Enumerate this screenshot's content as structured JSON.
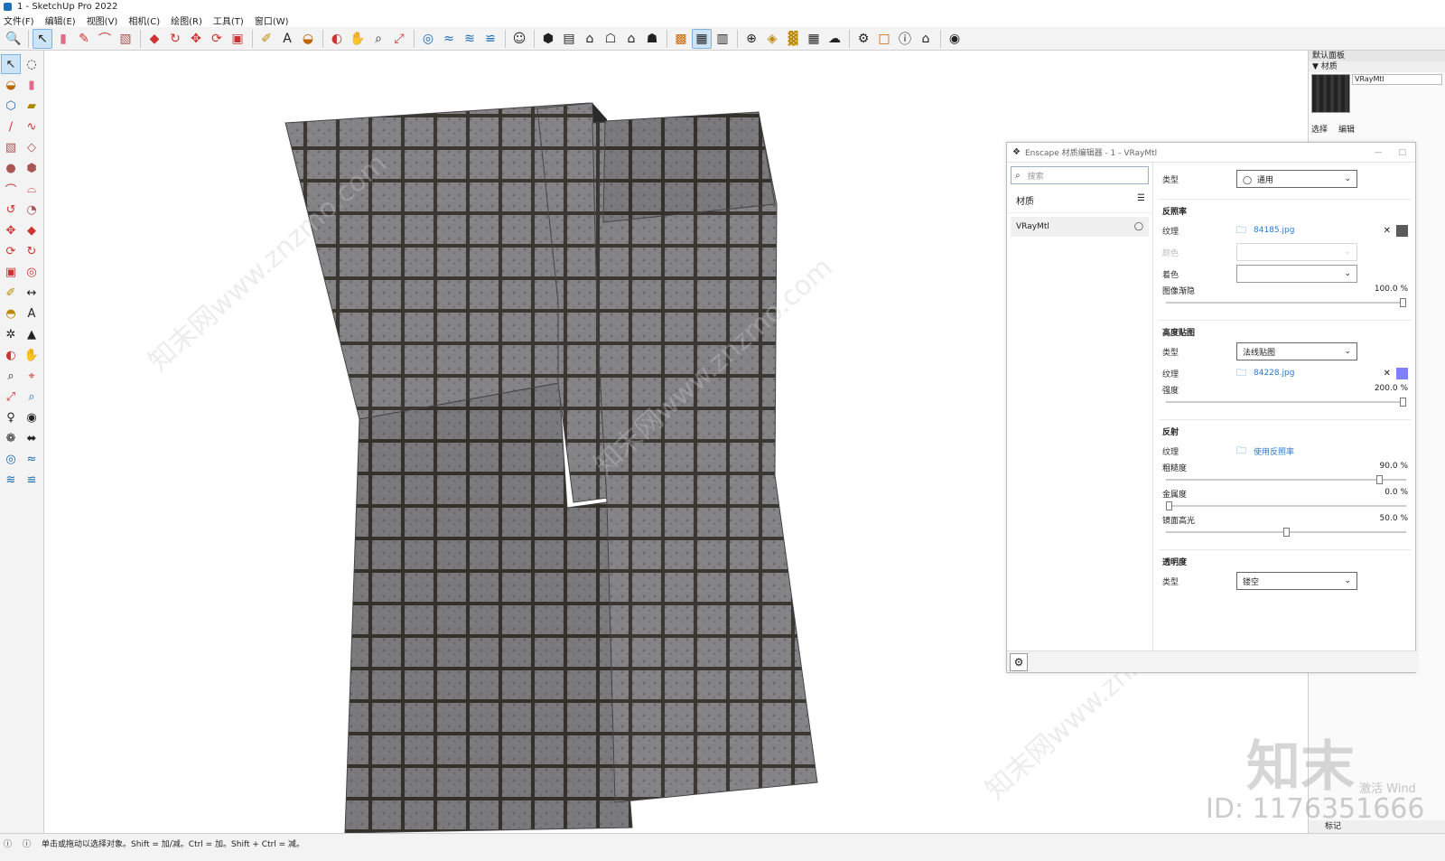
{
  "window": {
    "title": "1 - SketchUp Pro 2022"
  },
  "menu": [
    "文件(F)",
    "编辑(E)",
    "视图(V)",
    "相机(C)",
    "绘图(R)",
    "工具(T)",
    "窗口(W)"
  ],
  "tray": {
    "title": "默认面板",
    "section": "▼ 材质",
    "material_name": "VRayMtl",
    "tab_select": "选择",
    "tab_edit": "编辑",
    "bottom_label": "标记"
  },
  "status": {
    "hint": "单击或拖动以选择对象。Shift = 加/减。Ctrl = 加。Shift + Ctrl = 减。"
  },
  "enscape": {
    "title": "Enscape 材质编辑器 - 1 - VRayMtl",
    "search_placeholder": "搜索",
    "list_header": "材质",
    "list_item": "VRayMtl",
    "type_label": "类型",
    "type_value": "通用",
    "albedo": {
      "title": "反照率",
      "texture_label": "纹理",
      "texture_file": "84185.jpg",
      "color_label": "颜色",
      "tint_label": "着色",
      "fade_label": "图像渐隐",
      "fade_value": "100.0 %",
      "fade_fraction": 1.0,
      "swatch_color": "#5a5a5a"
    },
    "height": {
      "title": "高度贴图",
      "type_label": "类型",
      "type_value": "法线贴图",
      "texture_label": "纹理",
      "texture_file": "84228.jpg",
      "strength_label": "强度",
      "strength_value": "200.0 %",
      "strength_fraction": 1.0,
      "swatch_color": "#8080ff"
    },
    "reflection": {
      "title": "反射",
      "texture_label": "纹理",
      "texture_value": "使用反照率",
      "roughness_label": "粗糙度",
      "roughness_value": "90.0 %",
      "roughness_fraction": 0.9,
      "metallic_label": "金属度",
      "metallic_value": "0.0 %",
      "metallic_fraction": 0.0,
      "specular_label": "镜面高光",
      "specular_value": "50.0 %",
      "specular_fraction": 0.5
    },
    "transparency": {
      "title": "透明度",
      "type_label": "类型",
      "type_value": "镂空"
    }
  },
  "watermark": {
    "site": "知末网www.znzmo.com",
    "brand": "知末",
    "id": "ID: 1176351666",
    "activate": "激活 Wind"
  }
}
